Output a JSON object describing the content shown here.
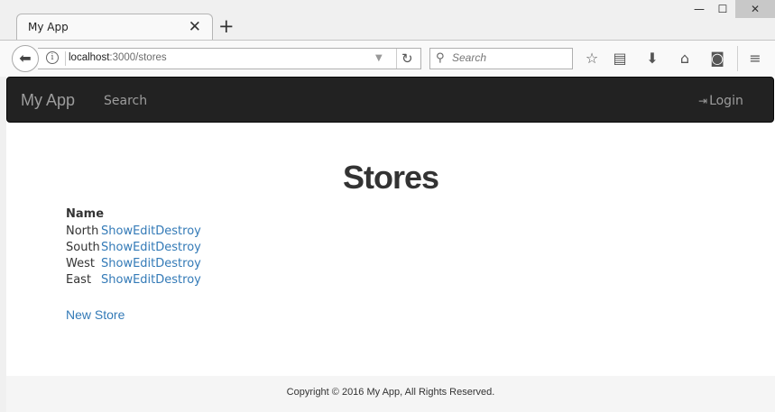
{
  "browser": {
    "tab_title": "My App",
    "tab_close_glyph": "✕",
    "new_tab_glyph": "+",
    "window_controls": {
      "minimize": "—",
      "maximize": "☐",
      "close": "✕"
    },
    "url_host": "localhost",
    "url_path": ":3000/stores",
    "search_placeholder": "Search",
    "icons": [
      "back-arrow-icon",
      "info-icon",
      "dropdown-icon",
      "reload-icon",
      "search-icon",
      "bookmark-star-icon",
      "reading-list-icon",
      "download-icon",
      "home-icon",
      "pocket-icon",
      "menu-icon"
    ]
  },
  "navbar": {
    "brand": "My App",
    "search_link": "Search",
    "login_link": "Login",
    "bg_color": "#222222"
  },
  "main": {
    "title": "Stores",
    "table_header": "Name",
    "stores": [
      {
        "name": "North",
        "show": "Show",
        "edit": "Edit",
        "destroy": "Destroy"
      },
      {
        "name": "South",
        "show": "Show",
        "edit": "Edit",
        "destroy": "Destroy"
      },
      {
        "name": "West",
        "show": "Show",
        "edit": "Edit",
        "destroy": "Destroy"
      },
      {
        "name": "East",
        "show": "Show",
        "edit": "Edit",
        "destroy": "Destroy"
      }
    ],
    "new_store_link": "New Store",
    "link_color": "#337ab7"
  },
  "footer": {
    "text": "Copyright © 2016 My App, All Rights Reserved."
  }
}
